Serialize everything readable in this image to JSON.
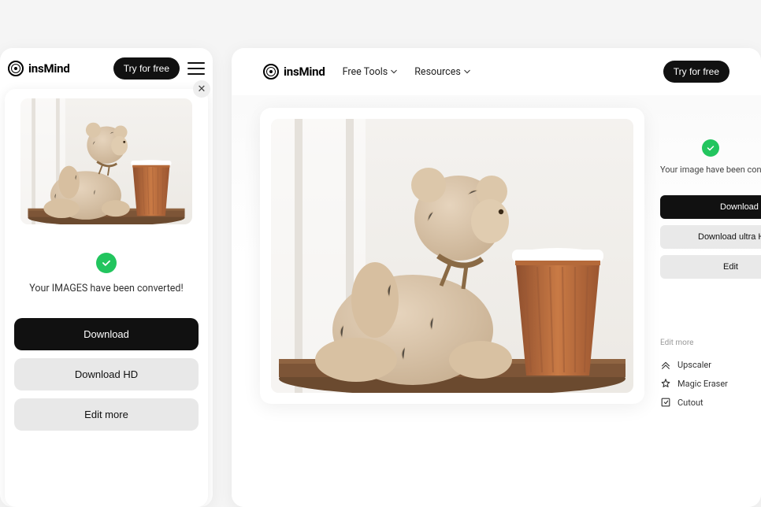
{
  "brand": "insMind",
  "mobile": {
    "try_button": "Try for free",
    "status": "Your IMAGES have been converted!",
    "buttons": {
      "download": "Download",
      "download_hd": "Download HD",
      "edit_more": "Edit more"
    }
  },
  "desktop": {
    "nav": {
      "free_tools": "Free Tools",
      "resources": "Resources"
    },
    "try_button": "Try for free",
    "status": "Your image have been converted!",
    "buttons": {
      "download": "Download",
      "download_ultra": "Download ultra HD",
      "edit": "Edit"
    },
    "edit_more_label": "Edit more",
    "tools": {
      "upscaler": "Upscaler",
      "magic_eraser": "Magic Eraser",
      "cutout": "Cutout"
    }
  }
}
